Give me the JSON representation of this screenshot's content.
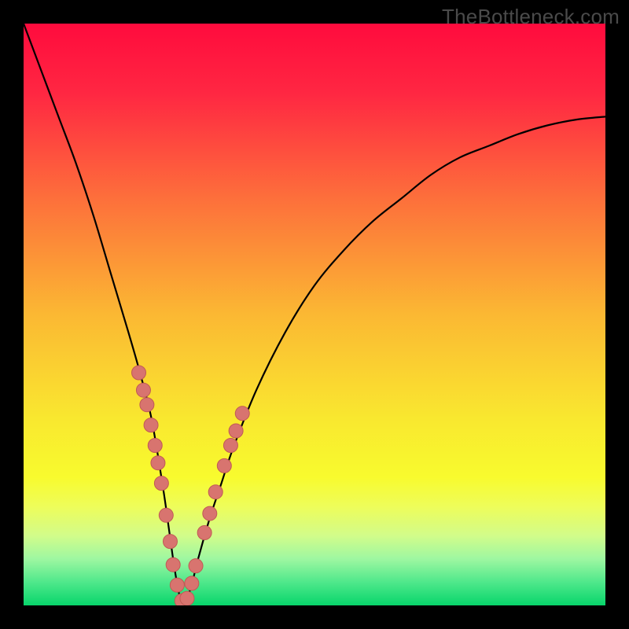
{
  "watermark": "TheBottleneck.com",
  "colors": {
    "background": "#000000",
    "gradient_stops": [
      {
        "pos": 0.0,
        "color": "#ff0b3d"
      },
      {
        "pos": 0.12,
        "color": "#ff2742"
      },
      {
        "pos": 0.3,
        "color": "#fd6f3b"
      },
      {
        "pos": 0.5,
        "color": "#fbb833"
      },
      {
        "pos": 0.68,
        "color": "#f9e82f"
      },
      {
        "pos": 0.78,
        "color": "#f8fb2e"
      },
      {
        "pos": 0.83,
        "color": "#eefd5a"
      },
      {
        "pos": 0.88,
        "color": "#d2fc8a"
      },
      {
        "pos": 0.92,
        "color": "#9ef7a1"
      },
      {
        "pos": 0.96,
        "color": "#4fe88b"
      },
      {
        "pos": 1.0,
        "color": "#08d56b"
      }
    ],
    "curve": "#000000",
    "marker_fill": "#d8746f",
    "marker_stroke": "#c05a55"
  },
  "chart_data": {
    "type": "line",
    "title": "",
    "xlabel": "",
    "ylabel": "",
    "xlim": [
      0,
      100
    ],
    "ylim": [
      0,
      100
    ],
    "note": "Axes are unlabeled. x is horizontal position (0=left,100=right); y is bottleneck-error-like metric (0=bottom/green,100=top/red). The curve reaches minimum near x≈27, y≈0.",
    "series": [
      {
        "name": "bottleneck-curve",
        "x": [
          0,
          3,
          6,
          9,
          12,
          15,
          18,
          20,
          22,
          24,
          25,
          26,
          27,
          28,
          29,
          30,
          32,
          34,
          36,
          40,
          45,
          50,
          55,
          60,
          65,
          70,
          75,
          80,
          85,
          90,
          95,
          100
        ],
        "y": [
          100,
          92,
          84,
          76,
          67,
          57,
          47,
          40,
          32,
          20,
          13,
          6,
          1,
          1,
          4,
          8,
          15,
          21,
          27,
          37,
          47,
          55,
          61,
          66,
          70,
          74,
          77,
          79,
          81,
          82.5,
          83.5,
          84
        ]
      }
    ],
    "markers": {
      "name": "highlight-points",
      "x": [
        19.8,
        20.6,
        21.2,
        21.9,
        22.6,
        23.1,
        23.7,
        24.5,
        25.2,
        25.7,
        26.4,
        27.2,
        28.1,
        28.9,
        29.6,
        31.1,
        32.0,
        33.0,
        34.5,
        35.6,
        36.5,
        37.6
      ],
      "y": [
        40.0,
        37.0,
        34.5,
        31.0,
        27.5,
        24.5,
        21.0,
        15.5,
        11.0,
        7.0,
        3.5,
        0.8,
        1.2,
        3.8,
        6.8,
        12.5,
        15.8,
        19.5,
        24.0,
        27.5,
        30.0,
        33.0
      ]
    }
  }
}
